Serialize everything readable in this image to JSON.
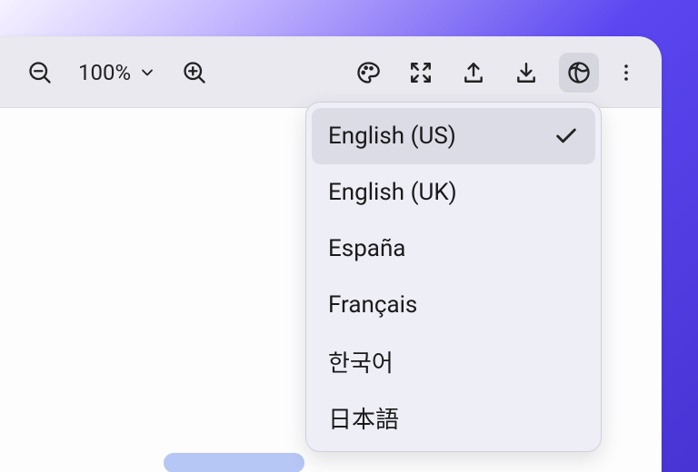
{
  "toolbar": {
    "zoom_label": "100%",
    "buttons": {
      "zoom_out": "zoom-out",
      "zoom_dropdown": "zoom-dropdown",
      "zoom_in": "zoom-in",
      "theme": "theme",
      "fullscreen": "fullscreen",
      "upload": "upload",
      "download": "download",
      "language": "language",
      "more": "more"
    }
  },
  "language_menu": {
    "selected_index": 0,
    "items": [
      {
        "label": "English (US)"
      },
      {
        "label": "English (UK)"
      },
      {
        "label": "España"
      },
      {
        "label": "Français"
      },
      {
        "label": "한국어"
      },
      {
        "label": "日本語"
      }
    ]
  }
}
